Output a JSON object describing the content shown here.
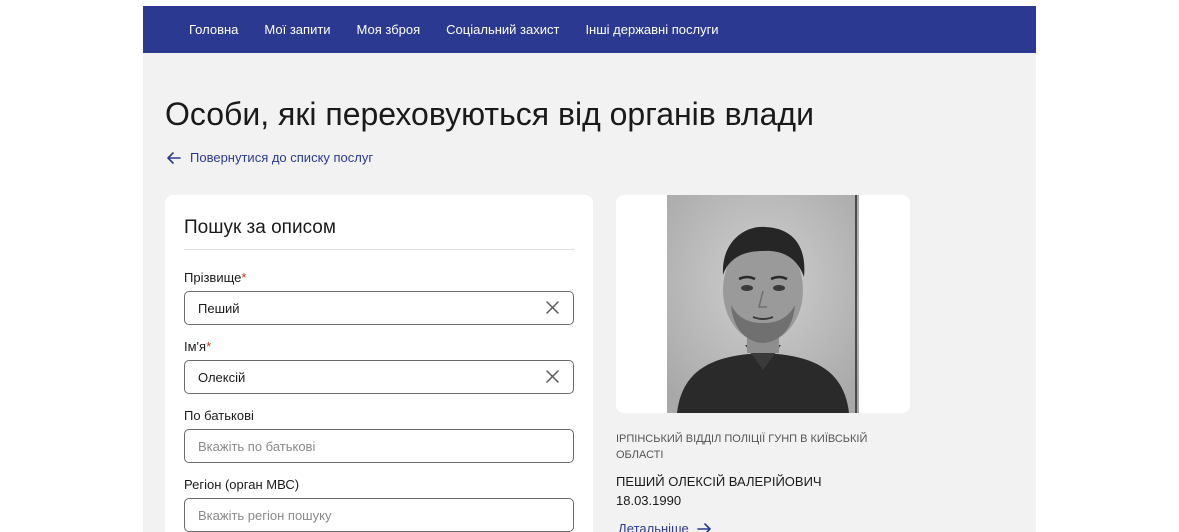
{
  "nav": {
    "items": [
      {
        "label": "Головна"
      },
      {
        "label": "Мої запити"
      },
      {
        "label": "Моя зброя"
      },
      {
        "label": "Соціальний захист"
      },
      {
        "label": "Інші державні послуги"
      }
    ],
    "color": "#2b3990"
  },
  "page": {
    "title": "Особи, які переховуються від органів влади",
    "back_link": "Повернутися до списку послуг"
  },
  "search": {
    "title": "Пошук за описом",
    "fields": [
      {
        "label": "Прізвище",
        "required": "*",
        "value": "Пеший",
        "placeholder": ""
      },
      {
        "label": "Ім'я",
        "required": "*",
        "value": "Олексій",
        "placeholder": ""
      },
      {
        "label": "По батькові",
        "value": "",
        "placeholder": "Вкажіть по батькові"
      },
      {
        "label": "Регіон (орган МВС)",
        "value": "",
        "placeholder": "Вкажіть регіон пошуку"
      }
    ]
  },
  "result": {
    "department": "Ірпінський відділ поліції ГУНП в Київській області",
    "name": "ПЕШИЙ ОЛЕКСІЙ ВАЛЕРІЙОВИЧ",
    "dob": "18.03.1990",
    "details_link": "Детальніше"
  },
  "icons": {
    "back": "arrow-left-icon",
    "clear": "close-icon",
    "details": "arrow-right-icon"
  }
}
